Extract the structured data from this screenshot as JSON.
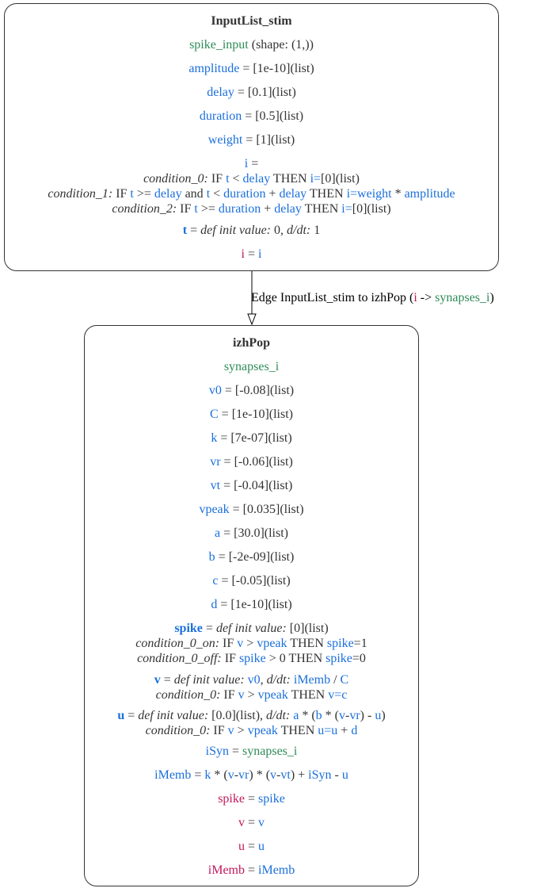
{
  "nodes": [
    {
      "title": "InputList_stim",
      "port": {
        "name": "spike_input",
        "rest": " (shape: (1,))"
      },
      "params": [
        {
          "name": "amplitude",
          "value": " = [1e-10](list)"
        },
        {
          "name": "delay",
          "value": " = [0.1](list)"
        },
        {
          "name": "duration",
          "value": " = [0.5](list)"
        },
        {
          "name": "weight",
          "value": " = [1](list)"
        }
      ],
      "i_block": {
        "head": {
          "var": "i",
          "eq": " ="
        },
        "c0": {
          "label": "condition_0:",
          "if": " IF ",
          "t": "t",
          "lt": " < ",
          "delay": "delay",
          "then": " THEN ",
          "assign": "i=",
          "rest": "[0](list)"
        },
        "c1": {
          "label": "condition_1:",
          "if": " IF ",
          "t": "t",
          "ge": " >= ",
          "delay": "delay",
          "and": " and ",
          "t2": "t",
          "lt": " < ",
          "duration": "duration",
          "plus": " + ",
          "delay2": "delay",
          "then": " THEN ",
          "assign": "i=weight",
          "times": " * ",
          "amplitude": "amplitude"
        },
        "c2": {
          "label": "condition_2:",
          "if": " IF ",
          "t": "t",
          "ge": " >= ",
          "duration": "duration",
          "plus": " + ",
          "delay": "delay",
          "then": " THEN ",
          "assign": "i=",
          "rest": "[0](list)"
        }
      },
      "t_state": {
        "var": "t",
        "eq": " = ",
        "def": "def init value:",
        "init": " 0, ",
        "dt": "d/dt:",
        "rate": " 1"
      },
      "output": {
        "var": "i",
        "eq": " = ",
        "val": "i"
      }
    },
    {
      "title": "izhPop",
      "port": {
        "name": "synapses_i"
      },
      "params": [
        {
          "name": "v0",
          "value": " = [-0.08](list)"
        },
        {
          "name": "C",
          "value": " = [1e-10](list)"
        },
        {
          "name": "k",
          "value": " = [7e-07](list)"
        },
        {
          "name": "vr",
          "value": " = [-0.06](list)"
        },
        {
          "name": "vt",
          "value": " = [-0.04](list)"
        },
        {
          "name": "vpeak",
          "value": " = [0.035](list)"
        },
        {
          "name": "a",
          "value": " = [30.0](list)"
        },
        {
          "name": "b",
          "value": " = [-2e-09](list)"
        },
        {
          "name": "c",
          "value": " = [-0.05](list)"
        },
        {
          "name": "d",
          "value": " = [1e-10](list)"
        }
      ],
      "spike_block": {
        "var": "spike",
        "eq": " = ",
        "def": "def init value:",
        "init": " [0](list)",
        "on": {
          "label": "condition_0_on:",
          "if": " IF ",
          "v": "v",
          "gt": " > ",
          "vpeak": "vpeak",
          "then": " THEN ",
          "assign": "spike",
          "rest": "=1"
        },
        "off": {
          "label": "condition_0_off:",
          "if": " IF ",
          "spike": "spike",
          "gt": " > 0 THEN ",
          "assign": "spike",
          "rest": "=0"
        }
      },
      "v_block": {
        "var": "v",
        "eq": " = ",
        "def": "def init value:",
        "sp": " ",
        "init": "v0",
        "comma": ", ",
        "dt": "d/dt:",
        "sp2": " ",
        "imemb": "iMemb",
        "div": " / ",
        "cvar": "C",
        "c0": {
          "label": "condition_0:",
          "if": " IF ",
          "v": "v",
          "gt": " > ",
          "vpeak": "vpeak",
          "then": " THEN ",
          "assign": "v=",
          "val": "c"
        }
      },
      "u_block": {
        "var": "u",
        "eq": " = ",
        "def": "def init value:",
        "init": " [0.0](list), ",
        "dt": "d/dt:",
        "sp": " ",
        "a": "a",
        "t1": " * (",
        "b": "b",
        "t2": " * (",
        "v": "v",
        "minus": "-",
        "vr": "vr",
        "t3": ") - ",
        "u": "u",
        "t4": ")",
        "c0": {
          "label": "condition_0:",
          "if": " IF ",
          "v": "v",
          "gt": " > ",
          "vpeak": "vpeak",
          "then": " THEN ",
          "assign": "u=u",
          "plus": " + ",
          "d": "d"
        }
      },
      "isyn": {
        "var": "iSyn",
        "eq": " = ",
        "val": "synapses_i"
      },
      "imemb": {
        "var": "iMemb",
        "eq": " = ",
        "k": "k",
        "t1": " * (",
        "v": "v",
        "m1": "-",
        "vr": "vr",
        "t2": ") * (",
        "v2": "v",
        "m2": "-",
        "vt": "vt",
        "t3": ") + ",
        "isyn": "iSyn",
        "m3": " - ",
        "u": "u"
      },
      "outputs": [
        {
          "var": "spike",
          "eq": " = ",
          "val": "spike"
        },
        {
          "var": "v",
          "eq": " = ",
          "val": "v"
        },
        {
          "var": "u",
          "eq": " = ",
          "val": "u"
        },
        {
          "var": "iMemb",
          "eq": " = ",
          "val": "iMemb"
        }
      ]
    }
  ],
  "edge": {
    "label_prefix": "Edge InputList_stim to izhPop (",
    "from": "i",
    "arrow": " -> ",
    "to": "synapses_i",
    "label_suffix": ")"
  },
  "colors": {
    "port": "#2e8b57",
    "param": "#1a6fdb",
    "output": "#c2185b",
    "text": "#333333"
  }
}
